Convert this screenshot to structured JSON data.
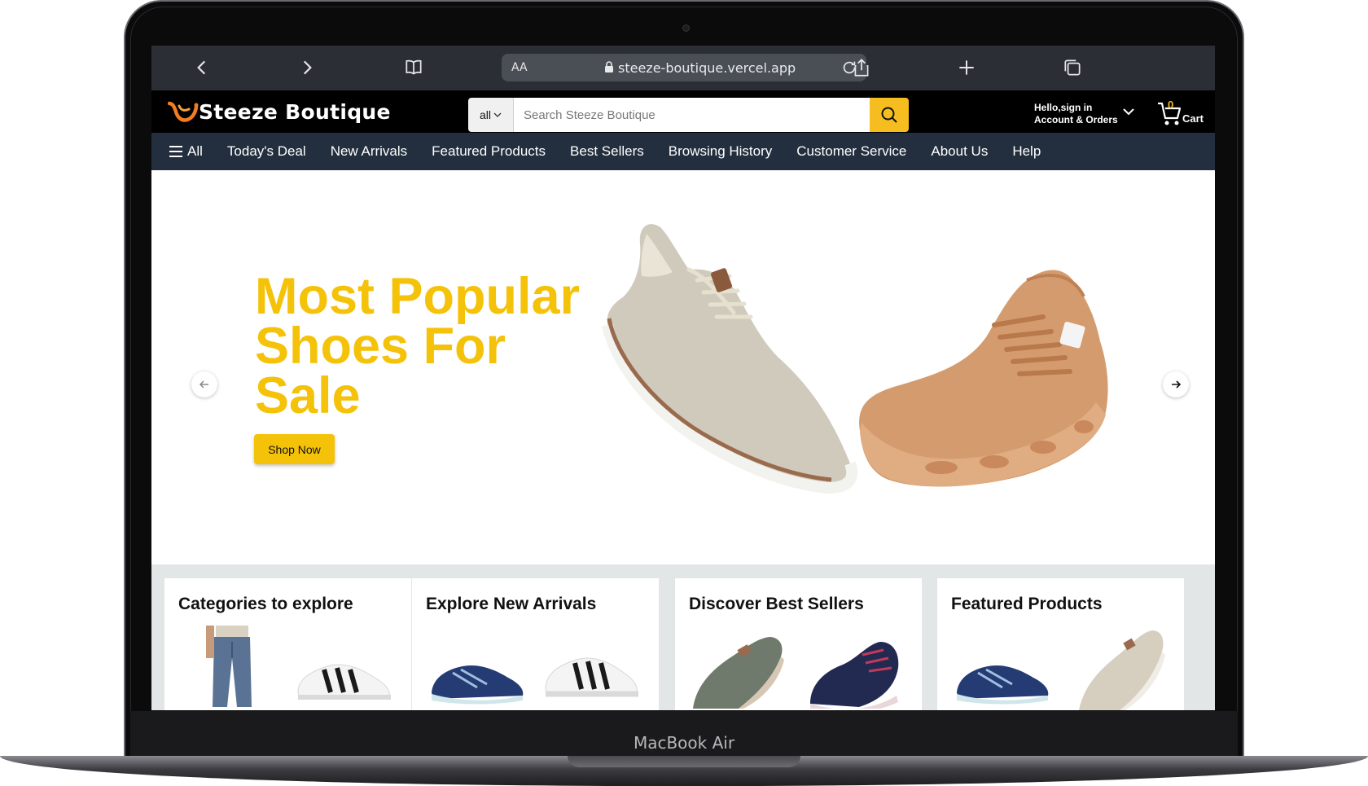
{
  "browser": {
    "url": "steeze-boutique.vercel.app",
    "reader_label": "AA",
    "icons": [
      "chevron-left-icon",
      "chevron-right-icon",
      "book-icon",
      "lock-icon",
      "reload-icon",
      "share-icon",
      "plus-icon",
      "tabs-icon"
    ]
  },
  "site": {
    "brand": "Steeze Boutique",
    "search": {
      "category": "all",
      "placeholder": "Search Steeze Boutique"
    },
    "account": {
      "line1": "Hello,sign in",
      "line2": "Account & Orders"
    },
    "cart": {
      "count": "0",
      "label": "Cart"
    },
    "nav": {
      "all_label": "All",
      "items": [
        "Today's Deal",
        "New Arrivals",
        "Featured Products",
        "Best Sellers",
        "Browsing History",
        "Customer Service",
        "About Us",
        "Help"
      ]
    },
    "hero": {
      "title": "Most Popular Shoes For Sale",
      "button": "Shop Now"
    },
    "cards": [
      {
        "title": "Categories to explore"
      },
      {
        "title": "Explore New Arrivals"
      },
      {
        "title": "Discover Best Sellers"
      },
      {
        "title": "Featured Products"
      }
    ]
  },
  "device": {
    "label": "MacBook Air"
  },
  "colors": {
    "accent": "#f5c20a",
    "nav_bg": "#232f3e",
    "header_bg": "#000000",
    "safari_bar": "#2b2f35"
  }
}
